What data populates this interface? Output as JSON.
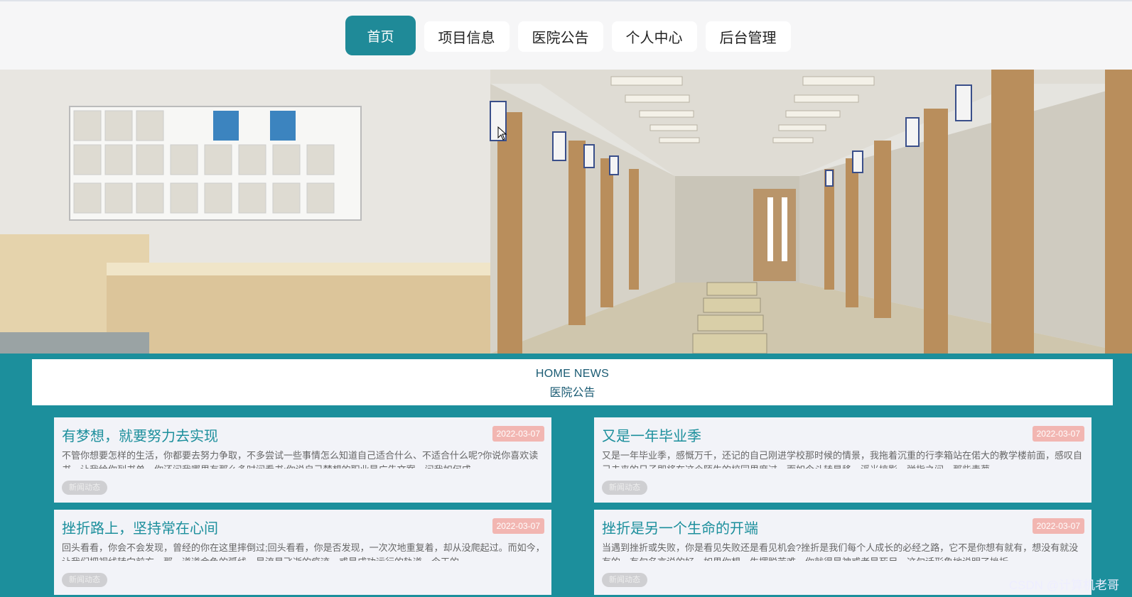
{
  "nav": {
    "items": [
      {
        "label": "首页",
        "active": true
      },
      {
        "label": "项目信息"
      },
      {
        "label": "医院公告"
      },
      {
        "label": "个人中心"
      },
      {
        "label": "后台管理"
      }
    ]
  },
  "banner": {
    "slide_count": 3,
    "active_slide": 1
  },
  "news": {
    "heading_en": "HOME NEWS",
    "heading_cn": "医院公告",
    "cards": [
      {
        "title": "有梦想，就要努力去实现",
        "date": "2022-03-07",
        "excerpt": "不管你想要怎样的生活，你都要去努力争取，不多尝试一些事情怎么知道自己适合什么、不适合什么呢?你说你喜欢读书，让我给你列书单，你还问我哪里有那么多时间看书;你说自己梦想的职业是广告文案，问我如何成",
        "tag": "新闻动态"
      },
      {
        "title": "又是一年毕业季",
        "date": "2022-03-07",
        "excerpt": "又是一年毕业季，感慨万千，还记的自己刚进学校那时候的情景，我拖着沉重的行李箱站在偌大的教学楼前面，感叹自己未来的日子即将在这个陌生的校园里度过，而如今斗转星移，浮光掠影，弹指之间，那些青葱",
        "tag": "新闻动态"
      },
      {
        "title": "挫折路上，坚持常在心间",
        "date": "2022-03-07",
        "excerpt": "回头看看，你会不会发现，曾经的你在这里摔倒过;回头看看，你是否发现，一次次地重复着，却从没爬起过。而如今，让我们把视线转向前方，那一道道金色的弧线，是流星飞逝的痕迹，或是成功运行的轨道，今天的",
        "tag": "新闻动态"
      },
      {
        "title": "挫折是另一个生命的开端",
        "date": "2022-03-07",
        "excerpt": "当遇到挫折或失败，你是看见失败还是看见机会?挫折是我们每个人成长的必经之路，它不是你想有就有，想没有就没有的。有句名言说的好，如果你想一生摆脱苦难，你就得是神或者是死尸。这句话形象地说明了挫折",
        "tag": "新闻动态"
      }
    ]
  },
  "watermark": "CSDN @计算机老哥",
  "colors": {
    "accent": "#1f8a98",
    "date_badge": "#f2b6b2",
    "card_bg": "#f2f3f8"
  }
}
